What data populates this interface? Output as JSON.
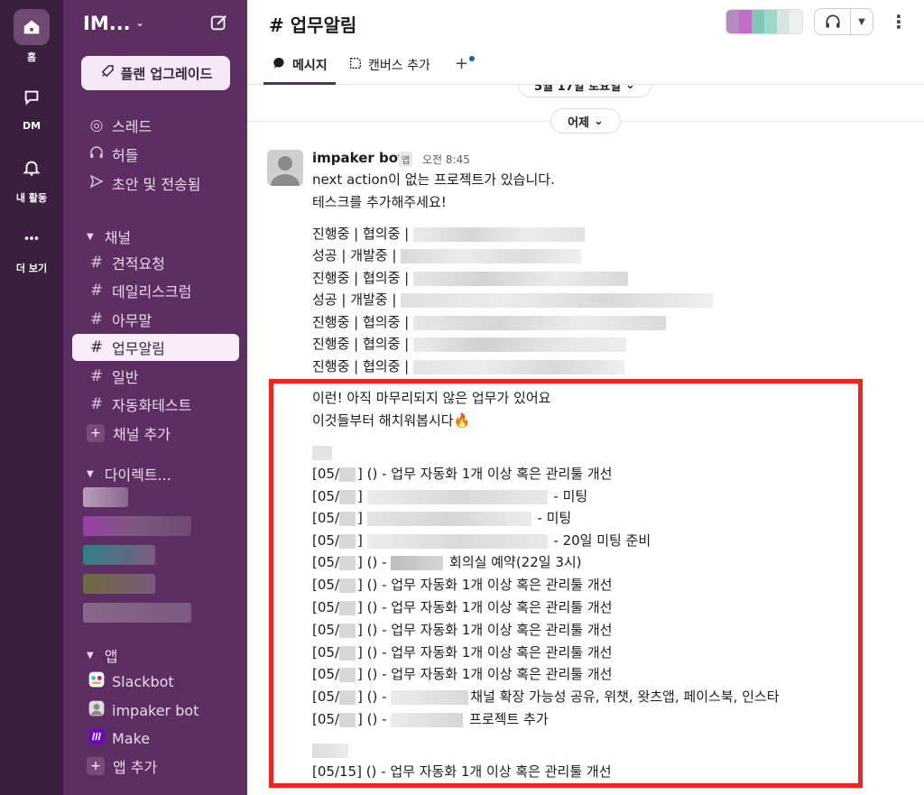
{
  "rail": {
    "items": [
      {
        "label": "홈",
        "icon": "home-icon"
      },
      {
        "label": "DM",
        "icon": "dm-icon"
      },
      {
        "label": "내 활동",
        "icon": "bell-icon"
      },
      {
        "label": "더 보기",
        "icon": "more-icon"
      }
    ]
  },
  "sidebar": {
    "workspace": "IM...",
    "upgrade": "플랜 업그레이드",
    "nav": [
      "스레드",
      "허들",
      "초안 및 전송됨"
    ],
    "channels_header": "채널",
    "channels": [
      "견적요청",
      "데일리스크럼",
      "아무말",
      "업무알림",
      "일반",
      "자동화테스트"
    ],
    "add_channel": "채널 추가",
    "dm_header": "다이렉트...",
    "apps_header": "앱",
    "apps": [
      "Slackbot",
      "impaker bot",
      "Make"
    ],
    "add_app": "앱 추가"
  },
  "header": {
    "hash": "#",
    "channel": "업무알림",
    "tabs": [
      "메시지",
      "캔버스 추가"
    ],
    "add": "+"
  },
  "messages": {
    "date_top": "5월 17일 토요일",
    "date_divider": "어제",
    "sender": "impaker bot",
    "badge": "앱",
    "time": "오전 8:45",
    "intro1": "next action이 없는 프로젝트가 있습니다.",
    "intro2": "테스크를 추가해주세요!",
    "status_lines": [
      "진행중 | 협의중 |",
      "성공 | 개발중 |",
      "진행중 | 협의중 |",
      "성공 | 개발중 |",
      "진행중 | 협의중 |",
      "진행중 | 협의중 |",
      "진행중 | 협의중 |"
    ],
    "alert1": "이런! 아직 마무리되지 않은 업무가 있어요",
    "alert2": "이것들부터 해치워봅시다🔥",
    "tasks": [
      {
        "prefix": "[05/",
        "suffix": "] () - 업무 자동화 1개 이상 혹은 관리툴 개선"
      },
      {
        "prefix": "[05/",
        "suffix": " - 미팅"
      },
      {
        "prefix": "[05/",
        "suffix": " - 미팅"
      },
      {
        "prefix": "[05/",
        "suffix": " - 20일 미팅 준비"
      },
      {
        "prefix": "[05/",
        "suffix": "] () - ",
        "tail": " 회의실 예약(22일 3시)"
      },
      {
        "prefix": "[05/",
        "suffix": "] () - 업무 자동화 1개 이상 혹은 관리툴 개선"
      },
      {
        "prefix": "[05/",
        "suffix": "] () - 업무 자동화 1개 이상 혹은 관리툴 개선"
      },
      {
        "prefix": "[05/",
        "suffix": "] () - 업무 자동화 1개 이상 혹은 관리툴 개선"
      },
      {
        "prefix": "[05/",
        "suffix": "] () - 업무 자동화 1개 이상 혹은 관리툴 개선"
      },
      {
        "prefix": "[05/",
        "suffix": "] () - 업무 자동화 1개 이상 혹은 관리툴 개선"
      },
      {
        "prefix": "[05/",
        "suffix": "] () - ",
        "tail": "채널 확장 가능성 공유, 위챗, 왓츠앱, 페이스북, 인스타"
      },
      {
        "prefix": "[05/",
        "suffix": "] () - ",
        "tail": " 프로젝트 추가"
      }
    ],
    "last_task": "[05/15] () - 업무 자동화 1개 이상 혹은 관리툴 개선"
  },
  "colors": {
    "rail": "#3b1f3f",
    "sidebar": "#5d2e61",
    "highlight": "#f0241c",
    "accent": "#1264a3"
  }
}
